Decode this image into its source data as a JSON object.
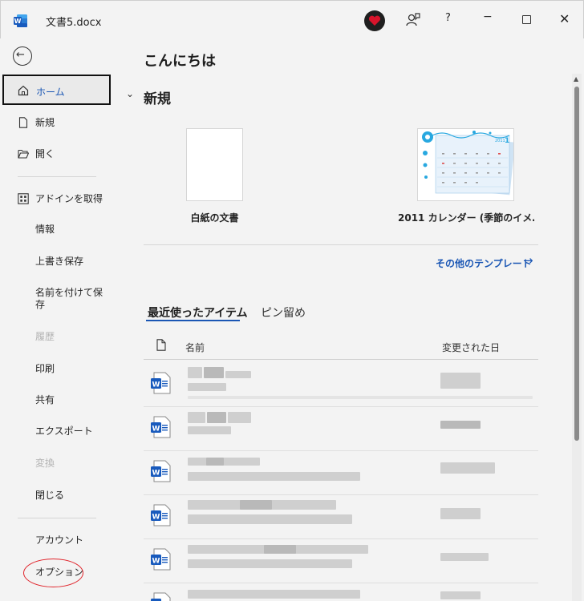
{
  "window": {
    "title": "文書5.docx",
    "help": "?",
    "minimize": "−",
    "close": "✕"
  },
  "sidebar": {
    "items": {
      "home": "ホーム",
      "new": "新規",
      "open": "開く",
      "addins": "アドインを取得",
      "info": "情報",
      "save": "上書き保存",
      "save_as": "名前を付けて保存",
      "history": "履歴",
      "print": "印刷",
      "share": "共有",
      "export": "エクスポート",
      "transform": "変換",
      "close": "閉じる",
      "account": "アカウント",
      "options": "オプション"
    }
  },
  "main": {
    "greeting": "こんにちは",
    "new_heading": "新規",
    "templates": [
      {
        "label": "白紙の文書"
      },
      {
        "label": "2011 カレンダー (季節のイメ…"
      }
    ],
    "more_templates": "その他のテンプレート",
    "tabs": {
      "recent": "最近使ったアイテム",
      "pinned": "ピン留め"
    },
    "columns": {
      "name": "名前",
      "modified": "変更された日"
    },
    "calendar_thumb": {
      "year": "2011",
      "month": "1"
    }
  },
  "colors": {
    "accent": "#1a56b4",
    "word_blue": "#185abd",
    "highlight_circle": "#e0242b"
  }
}
